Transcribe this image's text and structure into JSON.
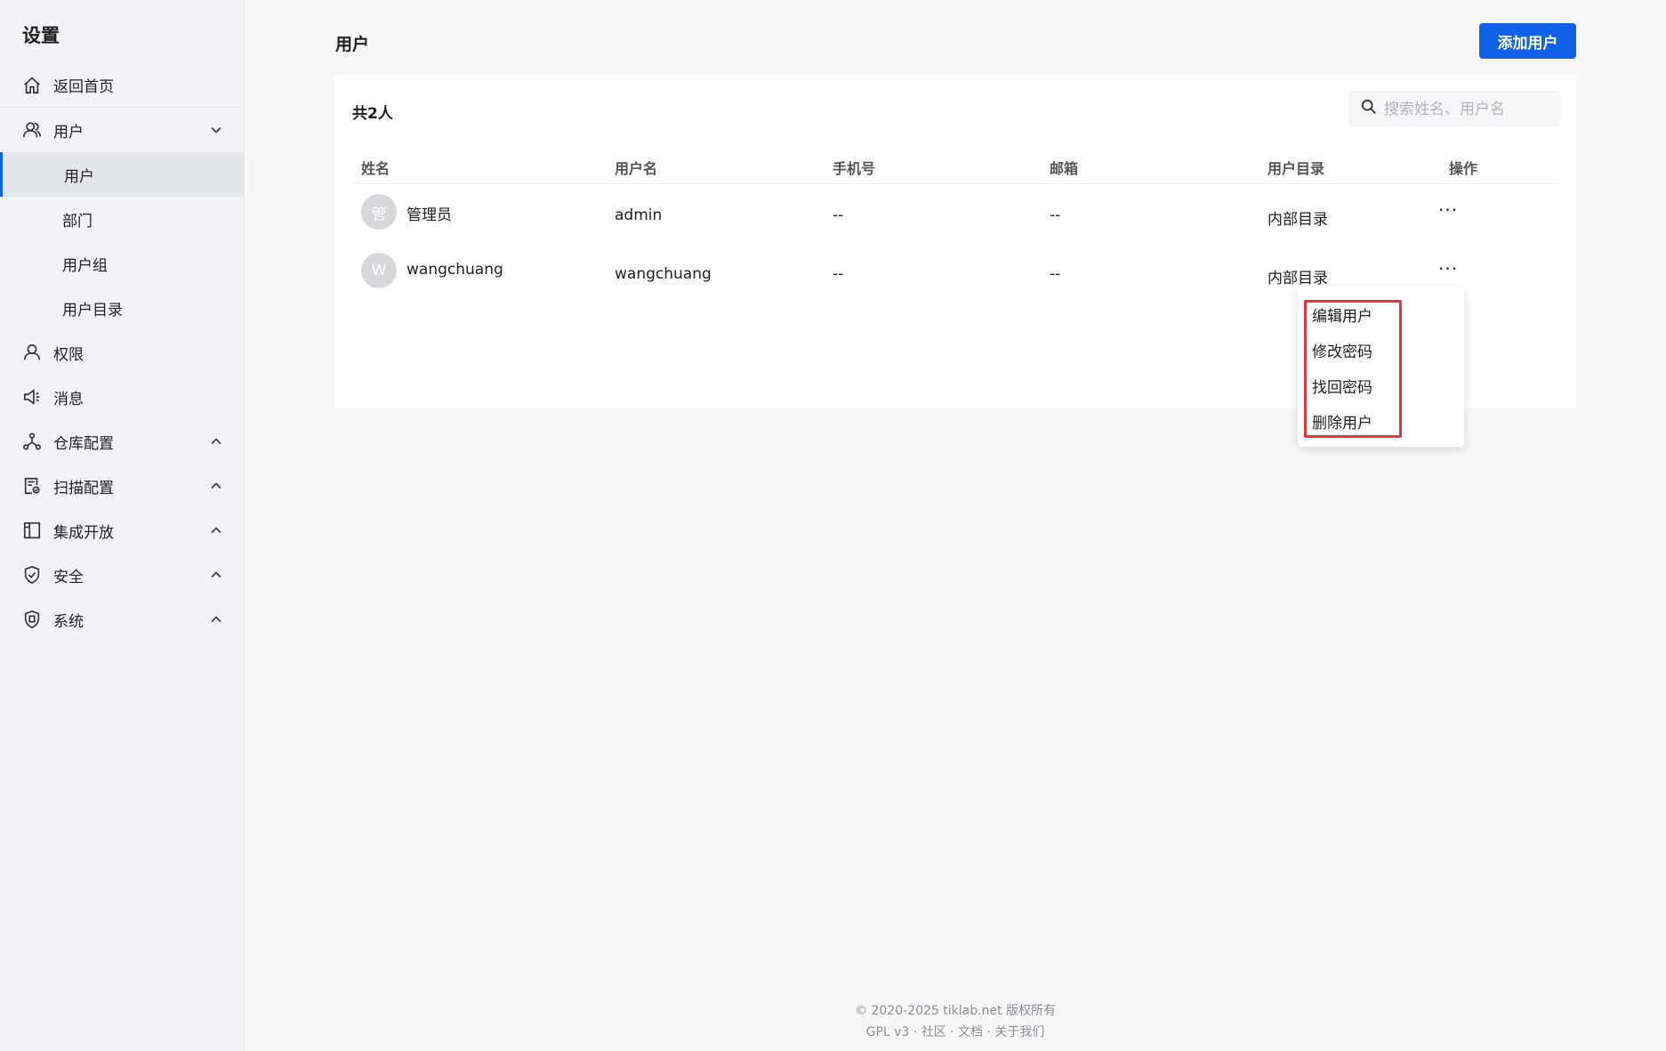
{
  "sidebar": {
    "title": "设置",
    "items": [
      {
        "label": "返回首页",
        "icon": "home-icon"
      },
      {
        "label": "用户",
        "icon": "users-icon",
        "expanded": true,
        "children": [
          {
            "label": "用户",
            "active": true
          },
          {
            "label": "部门"
          },
          {
            "label": "用户组"
          },
          {
            "label": "用户目录"
          }
        ]
      },
      {
        "label": "权限",
        "icon": "person-icon"
      },
      {
        "label": "消息",
        "icon": "megaphone-icon"
      },
      {
        "label": "仓库配置",
        "icon": "nodes-icon"
      },
      {
        "label": "扫描配置",
        "icon": "scan-doc-icon"
      },
      {
        "label": "集成开放",
        "icon": "layout-icon"
      },
      {
        "label": "安全",
        "icon": "shield-check-icon"
      },
      {
        "label": "系统",
        "icon": "shield-badge-icon"
      }
    ]
  },
  "header": {
    "title": "用户",
    "add_button": "添加用户"
  },
  "table": {
    "count_label": "共2人",
    "search_placeholder": "搜索姓名、用户名",
    "columns": [
      "姓名",
      "用户名",
      "手机号",
      "邮箱",
      "用户目录",
      "操作"
    ],
    "rows": [
      {
        "avatar": "管",
        "name": "管理员",
        "username": "admin",
        "phone": "--",
        "email": "--",
        "directory": "内部目录",
        "actions": "···"
      },
      {
        "avatar": "W",
        "name": "wangchuang",
        "username": "wangchuang",
        "phone": "--",
        "email": "--",
        "directory": "内部目录",
        "actions": "···"
      }
    ]
  },
  "dropdown": {
    "items": [
      "编辑用户",
      "修改密码",
      "找回密码",
      "删除用户"
    ]
  },
  "footer": {
    "copyright": "© 2020-2025 tiklab.net 版权所有",
    "license": "GPL v3",
    "sep": "·",
    "community": "社区",
    "docs": "文档",
    "about": "关于我们"
  },
  "colors": {
    "accent": "#1160e8",
    "highlight": "#e0363b",
    "sidebar_bg": "#f1f3f6"
  }
}
